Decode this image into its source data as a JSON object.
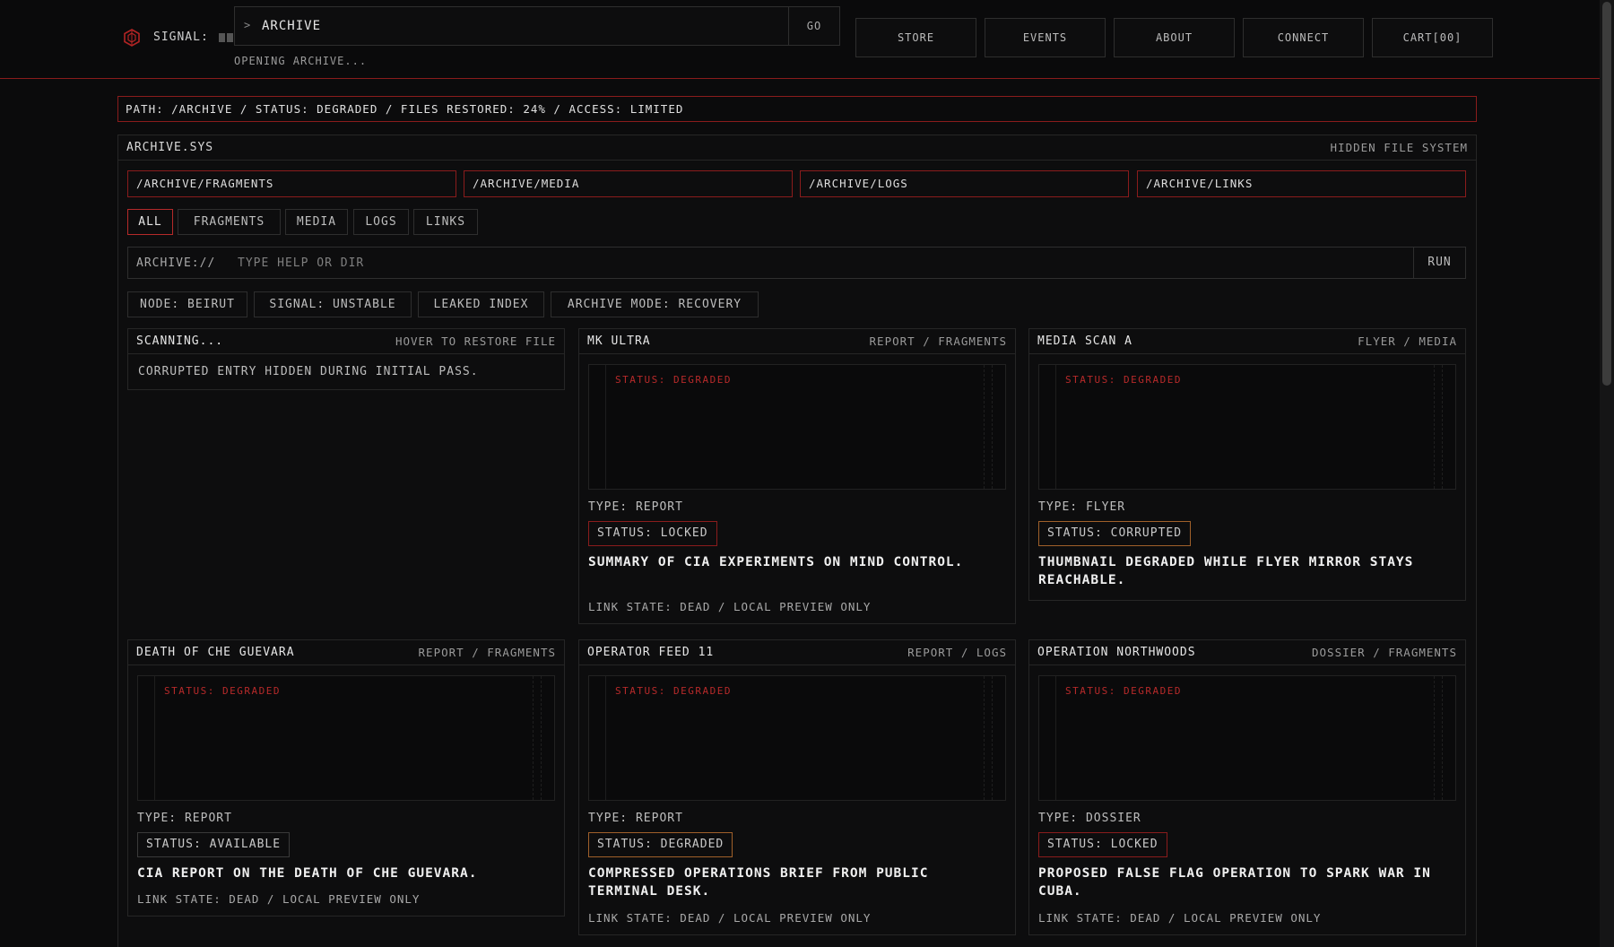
{
  "header": {
    "signal_label": "SIGNAL:",
    "command": {
      "prompt_icon": "chevron-right-icon",
      "value": "ARCHIVE",
      "go_label": "GO"
    },
    "command_status": "OPENING ARCHIVE...",
    "nav": [
      "STORE",
      "EVENTS",
      "ABOUT",
      "CONNECT",
      "CART[00]"
    ]
  },
  "path_bar": "PATH: /ARCHIVE / STATUS: DEGRADED / FILES RESTORED: 24% / ACCESS: LIMITED",
  "panel": {
    "title": "ARCHIVE.SYS",
    "subtitle": "HIDDEN FILE SYSTEM",
    "dirs": [
      "/ARCHIVE/FRAGMENTS",
      "/ARCHIVE/MEDIA",
      "/ARCHIVE/LOGS",
      "/ARCHIVE/LINKS"
    ],
    "filters": [
      "ALL",
      "FRAGMENTS",
      "MEDIA",
      "LOGS",
      "LINKS"
    ],
    "active_filter": "ALL",
    "terminal": {
      "label": "ARCHIVE://",
      "placeholder": "TYPE HELP OR DIR",
      "run_label": "RUN"
    },
    "tags": [
      "NODE: BEIRUT",
      "SIGNAL: UNSTABLE",
      "LEAKED INDEX",
      "ARCHIVE MODE: RECOVERY"
    ]
  },
  "scanning_card": {
    "title": "SCANNING...",
    "hint": "HOVER TO RESTORE FILE",
    "body": "CORRUPTED ENTRY HIDDEN DURING INITIAL PASS."
  },
  "cards": [
    {
      "title": "MK ULTRA",
      "category": "REPORT / FRAGMENTS",
      "thumb_status": "STATUS: DEGRADED",
      "type": "TYPE: REPORT",
      "status": "STATUS: LOCKED",
      "status_color": "#8a1c1c",
      "desc": "SUMMARY OF CIA EXPERIMENTS ON MIND CONTROL.",
      "link": "LINK STATE: DEAD / LOCAL PREVIEW ONLY"
    },
    {
      "title": "MEDIA SCAN A",
      "category": "FLYER / MEDIA",
      "thumb_status": "STATUS: DEGRADED",
      "type": "TYPE: FLYER",
      "status": "STATUS: CORRUPTED",
      "status_color": "#a0602a",
      "desc": "THUMBNAIL DEGRADED WHILE FLYER MIRROR STAYS REACHABLE.",
      "link": ""
    },
    {
      "title": "DEATH OF CHE GUEVARA",
      "category": "REPORT / FRAGMENTS",
      "thumb_status": "STATUS: DEGRADED",
      "type": "TYPE: REPORT",
      "status": "STATUS: AVAILABLE",
      "status_color": "#3a3a3a",
      "desc": "CIA REPORT ON THE DEATH OF CHE GUEVARA.",
      "link": "LINK STATE: DEAD / LOCAL PREVIEW ONLY"
    },
    {
      "title": "OPERATOR FEED 11",
      "category": "REPORT / LOGS",
      "thumb_status": "STATUS: DEGRADED",
      "type": "TYPE: REPORT",
      "status": "STATUS: DEGRADED",
      "status_color": "#a0602a",
      "desc": "COMPRESSED OPERATIONS BRIEF FROM PUBLIC TERMINAL DESK.",
      "link": "LINK STATE: DEAD / LOCAL PREVIEW ONLY"
    },
    {
      "title": "OPERATION NORTHWOODS",
      "category": "DOSSIER / FRAGMENTS",
      "thumb_status": "STATUS: DEGRADED",
      "type": "TYPE: DOSSIER",
      "status": "STATUS: LOCKED",
      "status_color": "#8a1c1c",
      "desc": "PROPOSED FALSE FLAG OPERATION TO SPARK WAR IN CUBA.",
      "link": "LINK STATE: DEAD / LOCAL PREVIEW ONLY"
    }
  ],
  "theme": {
    "accent": "#8a1c1c",
    "amber": "#a0602a",
    "background": "#0b0b0c"
  }
}
